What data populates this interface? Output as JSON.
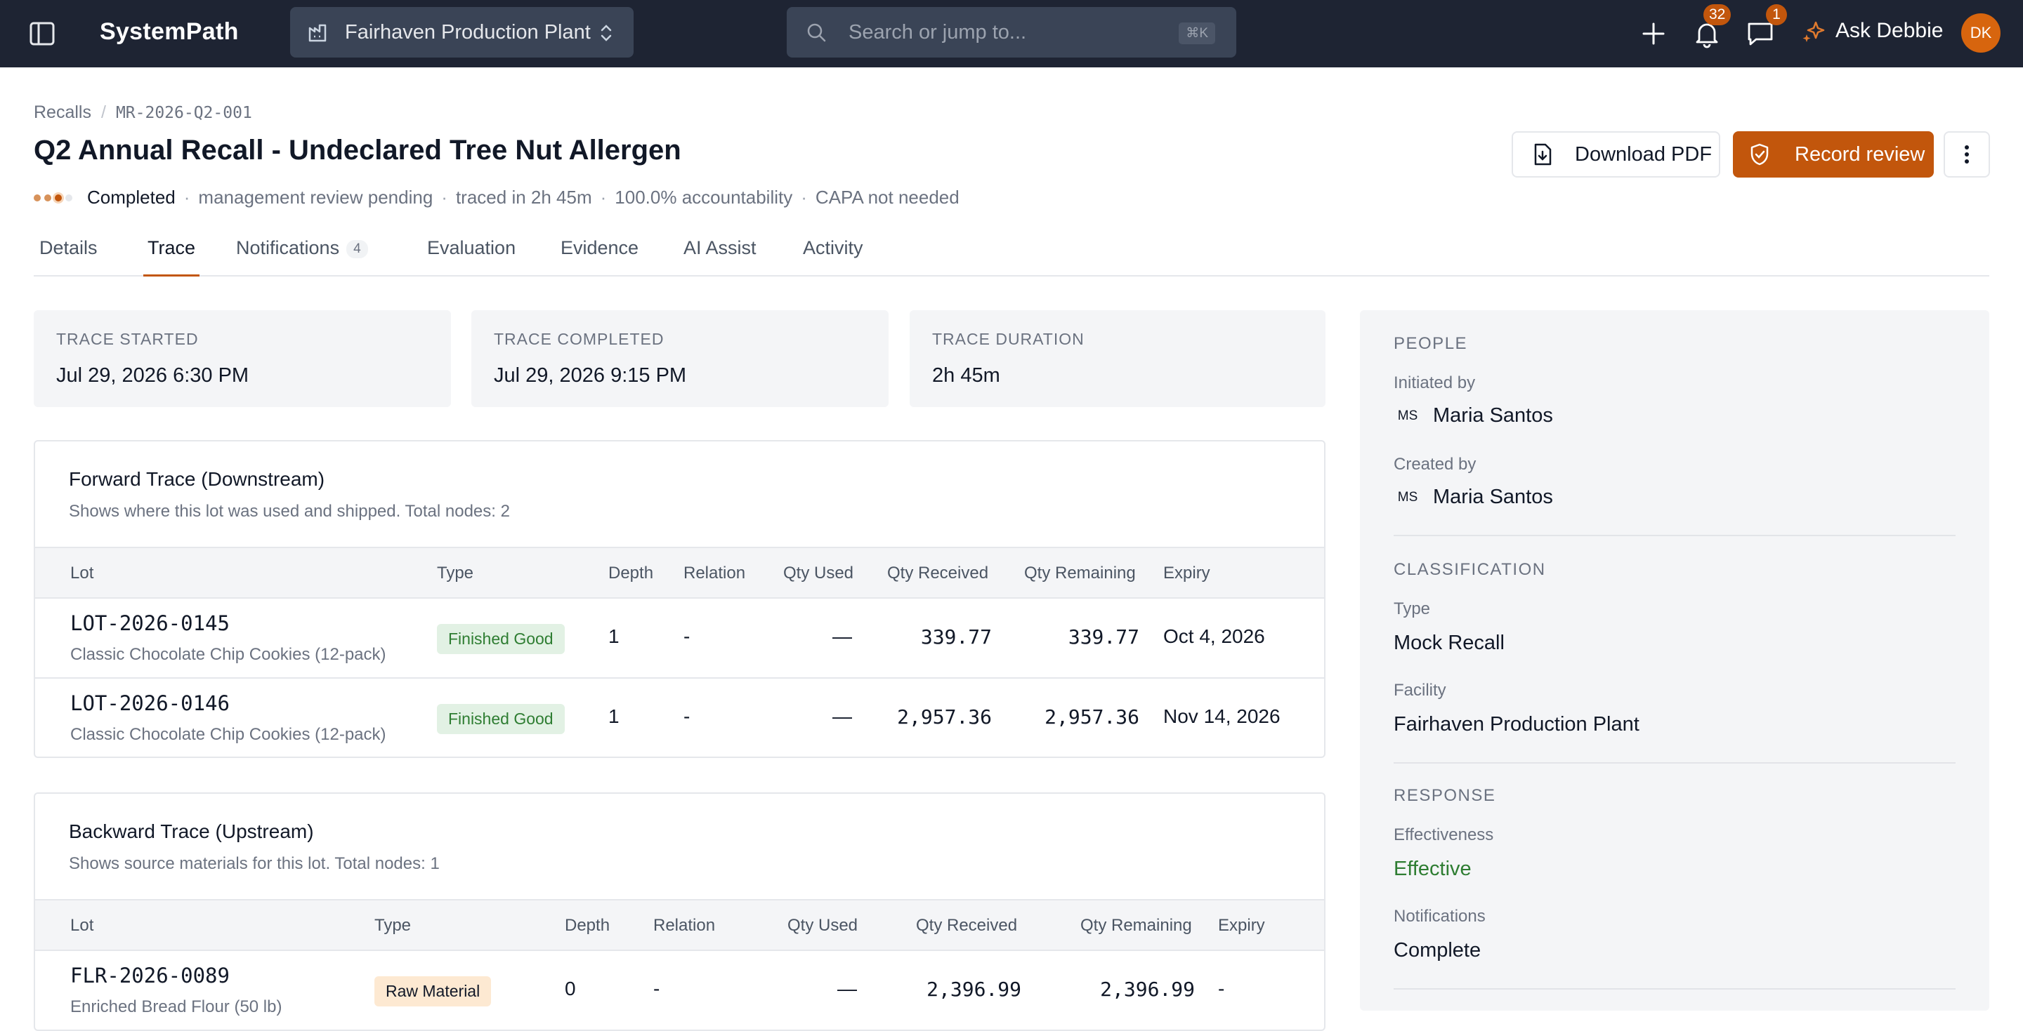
{
  "topbar": {
    "brand": "SystemPath",
    "facility": "Fairhaven Production Plant",
    "search_placeholder": "Search or jump to...",
    "search_shortcut": "⌘K",
    "notifications_count": "32",
    "messages_count": "1",
    "ask_label": "Ask Debbie",
    "avatar_initials": "DK"
  },
  "breadcrumb": {
    "root": "Recalls",
    "current": "MR-2026-Q2-001"
  },
  "header": {
    "title": "Q2 Annual Recall - Undeclared Tree Nut Allergen",
    "status": "Completed",
    "meta1": "management review pending",
    "meta2": "traced in 2h 45m",
    "meta3": "100.0% accountability",
    "meta4": "CAPA not needed",
    "download_label": "Download PDF",
    "review_label": "Record review"
  },
  "tabs": [
    {
      "label": "Details"
    },
    {
      "label": "Trace"
    },
    {
      "label": "Notifications",
      "count": "4"
    },
    {
      "label": "Evaluation"
    },
    {
      "label": "Evidence"
    },
    {
      "label": "AI Assist"
    },
    {
      "label": "Activity"
    }
  ],
  "stats": [
    {
      "label": "TRACE STARTED",
      "value": "Jul 29, 2026 6:30 PM"
    },
    {
      "label": "TRACE COMPLETED",
      "value": "Jul 29, 2026 9:15 PM"
    },
    {
      "label": "TRACE DURATION",
      "value": "2h 45m"
    }
  ],
  "forward": {
    "title": "Forward Trace (Downstream)",
    "subtitle": "Shows where this lot was used and shipped. Total nodes: 2",
    "columns": [
      "Lot",
      "Type",
      "Depth",
      "Relation",
      "Qty Used",
      "Qty Received",
      "Qty Remaining",
      "Expiry"
    ],
    "rows": [
      {
        "lot": "LOT-2026-0145",
        "desc": "Classic Chocolate Chip Cookies (12-pack)",
        "type": "Finished Good",
        "depth": "1",
        "relation": "-",
        "qty_used": "—",
        "qty_received": "339.77",
        "qty_remaining": "339.77",
        "expiry": "Oct 4, 2026"
      },
      {
        "lot": "LOT-2026-0146",
        "desc": "Classic Chocolate Chip Cookies (12-pack)",
        "type": "Finished Good",
        "depth": "1",
        "relation": "-",
        "qty_used": "—",
        "qty_received": "2,957.36",
        "qty_remaining": "2,957.36",
        "expiry": "Nov 14, 2026"
      }
    ]
  },
  "backward": {
    "title": "Backward Trace (Upstream)",
    "subtitle": "Shows source materials for this lot. Total nodes: 1",
    "columns": [
      "Lot",
      "Type",
      "Depth",
      "Relation",
      "Qty Used",
      "Qty Received",
      "Qty Remaining",
      "Expiry"
    ],
    "rows": [
      {
        "lot": "FLR-2026-0089",
        "desc": "Enriched Bread Flour (50 lb)",
        "type": "Raw Material",
        "depth": "0",
        "relation": "-",
        "qty_used": "—",
        "qty_received": "2,396.99",
        "qty_remaining": "2,396.99",
        "expiry": "-"
      }
    ]
  },
  "sidebar": {
    "people_title": "PEOPLE",
    "initiated_label": "Initiated by",
    "initiated_initials": "MS",
    "initiated_name": "Maria Santos",
    "created_label": "Created by",
    "created_initials": "MS",
    "created_name": "Maria Santos",
    "classification_title": "CLASSIFICATION",
    "type_label": "Type",
    "type_value": "Mock Recall",
    "facility_label": "Facility",
    "facility_value": "Fairhaven Production Plant",
    "response_title": "RESPONSE",
    "effectiveness_label": "Effectiveness",
    "effectiveness_value": "Effective",
    "notifications_label": "Notifications",
    "notifications_value": "Complete"
  },
  "colors": {
    "accent": "#c2560c",
    "topbar": "#1e2433",
    "success": "#2e7d32"
  }
}
